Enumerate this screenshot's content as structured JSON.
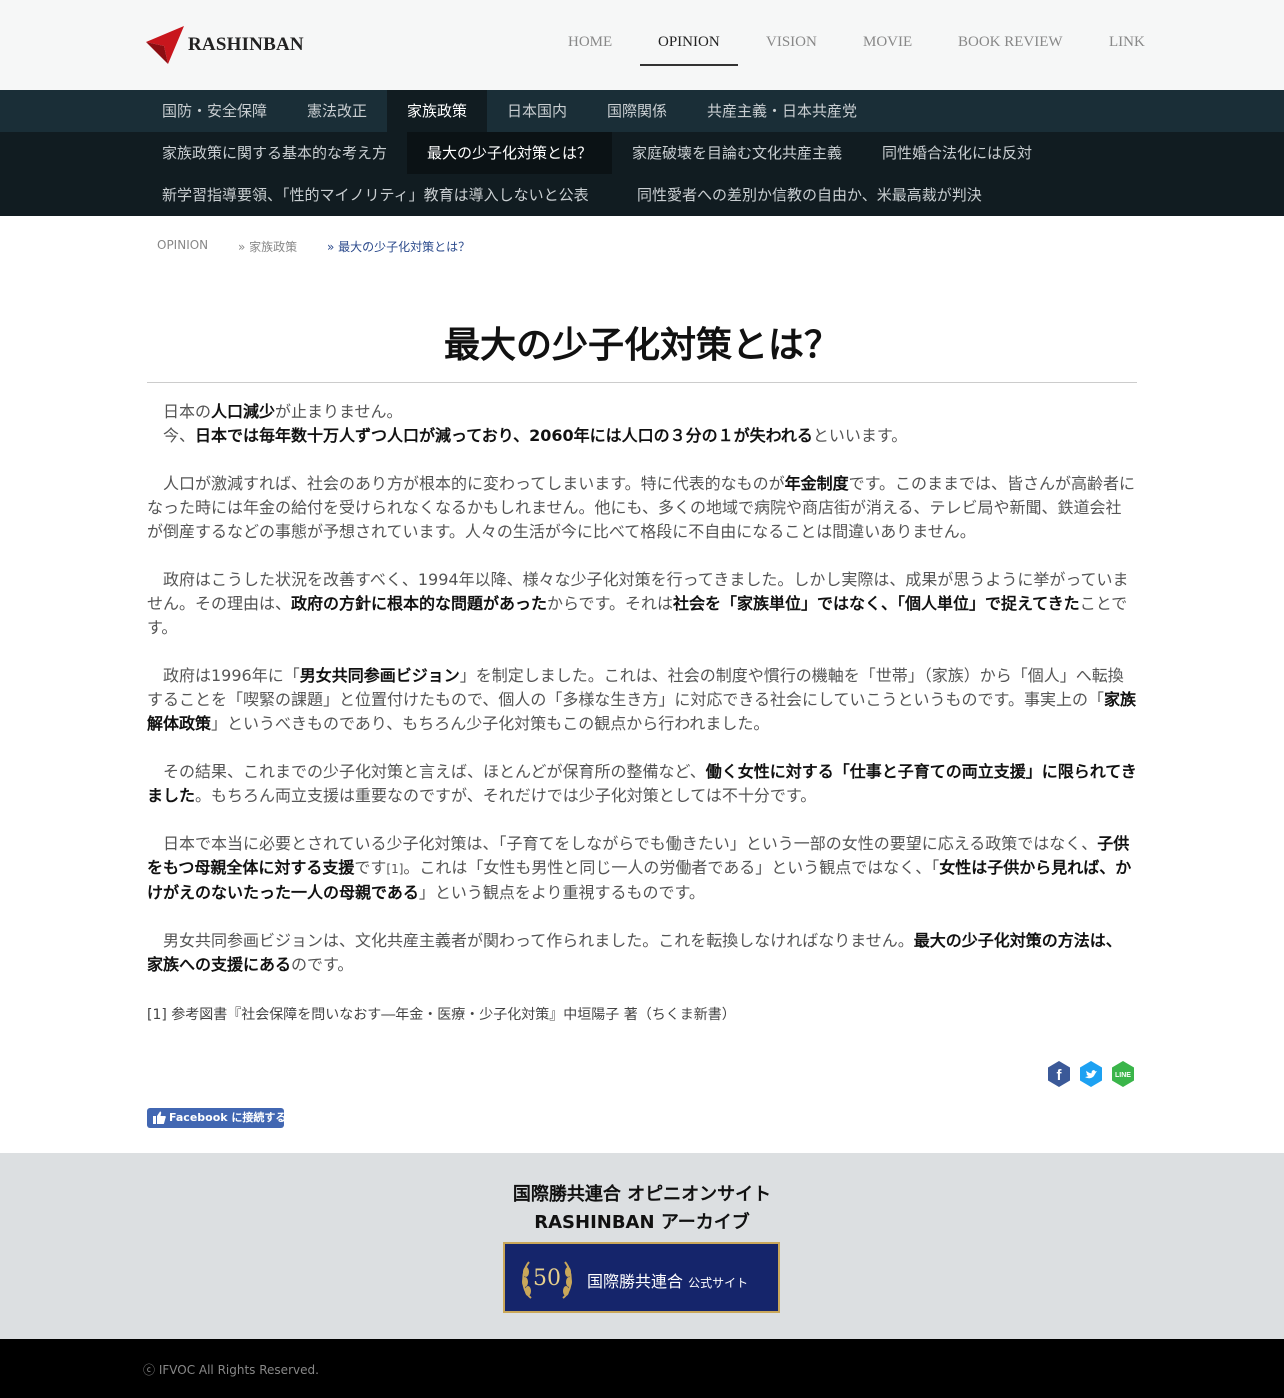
{
  "header": {
    "logo_text": "RASHINBAN",
    "nav": [
      {
        "label": "HOME",
        "active": false
      },
      {
        "label": "OPINION",
        "active": true
      },
      {
        "label": "VISION",
        "active": false
      },
      {
        "label": "MOVIE",
        "active": false
      },
      {
        "label": "BOOK REVIEW",
        "active": false
      },
      {
        "label": "LINK",
        "active": false
      }
    ]
  },
  "categories": [
    {
      "label": "国防・安全保障",
      "active": false
    },
    {
      "label": "憲法改正",
      "active": false
    },
    {
      "label": "家族政策",
      "active": true
    },
    {
      "label": "日本国内",
      "active": false
    },
    {
      "label": "国際関係",
      "active": false
    },
    {
      "label": "共産主義・日本共産党",
      "active": false
    }
  ],
  "subcategories": [
    {
      "label": "家族政策に関する基本的な考え方",
      "active": false
    },
    {
      "label": "最大の少子化対策とは？",
      "active": true
    },
    {
      "label": "家庭破壊を目論む文化共産主義",
      "active": false
    },
    {
      "label": "同性婚合法化には反対",
      "active": false
    },
    {
      "label": "新学習指導要領、「性的マイノリティ」教育は導入しないと公表",
      "active": false
    },
    {
      "label": "同性愛者への差別か信教の自由か、米最高裁が判決",
      "active": false
    }
  ],
  "breadcrumb": {
    "root": "OPINION",
    "parent": "» 家族政策",
    "current": "» 最大の少子化対策とは？"
  },
  "article": {
    "title": "最大の少子化対策とは？",
    "p1a": "日本の",
    "p1b": "人口減少",
    "p1c": "が止まりません。",
    "p2a": "今、",
    "p2b": "日本では毎年数十万人ずつ人口が減っており、2060年には人口の３分の１が失われる",
    "p2c": "といいます。",
    "p3a": "人口が激減すれば、社会のあり方が根本的に変わってしまいます。特に代表的なものが",
    "p3b": "年金制度",
    "p3c": "です。このままでは、皆さんが高齢者になった時には年金の給付を受けられなくなるかもしれません。他にも、多くの地域で病院や商店街が消える、テレビ局や新聞、鉄道会社が倒産するなどの事態が予想されています。人々の生活が今に比べて格段に不自由になることは間違いありません。",
    "p4a": "政府はこうした状況を改善すべく、1994年以降、様々な少子化対策を行ってきました。しかし実際は、成果が思うように挙がっていません。その理由は、",
    "p4b": "政府の方針に根本的な問題があった",
    "p4c": "からです。それは",
    "p4d": "社会を「家族単位」ではなく、「個人単位」で捉えてきた",
    "p4e": "ことです。",
    "p5a": "政府は1996年に「",
    "p5b": "男女共同参画ビジョン",
    "p5c": "」を制定しました。これは、社会の制度や慣行の機軸を「世帯」（家族）から「個人」へ転換することを「喫緊の課題」と位置付けたもので、個人の「多様な生き方」に対応できる社会にしていこうというものです。事実上の「",
    "p5d": "家族解体政策",
    "p5e": "」というべきものであり、もちろん少子化対策もこの観点から行われました。",
    "p6a": "その結果、これまでの少子化対策と言えば、ほとんどが保育所の整備など、",
    "p6b": "働く女性に対する「仕事と子育ての両立支援」に限られてきました",
    "p6c": "。もちろん両立支援は重要なのですが、それだけでは少子化対策としては不十分です。",
    "p7a": "日本で本当に必要とされている少子化対策は、「子育てをしながらでも働きたい」という一部の女性の要望に応える政策ではなく、",
    "p7b": "子供をもつ母親全体に対する支援",
    "p7c": "です",
    "p7ref": "[1]",
    "p7d": "。これは「女性も男性と同じ一人の労働者である」という観点ではなく、「",
    "p7e": "女性は子供から見れば、かけがえのないたった一人の母親である",
    "p7f": "」という観点をより重視するものです。",
    "p8a": "男女共同参画ビジョンは、文化共産主義者が関わって作られました。これを転換しなければなりません。",
    "p8b": "最大の少子化対策の方法は、家族への支援にある",
    "p8c": "のです。",
    "footnote": "[1] 参考図書『社会保障を問いなおす―年金・医療・少子化対策』中垣陽子 著（ちくま新書）"
  },
  "share": {
    "facebook_color": "#3b5998",
    "twitter_color": "#1da1f2",
    "line_color": "#3ab54a",
    "line_label": "LINE"
  },
  "fb_connect_label": "Facebook に接続する",
  "footer": {
    "line1": "国際勝共連合 オピニオンサイト",
    "line2": "RASHINBAN アーカイブ",
    "banner_badge": "50",
    "banner_text": "国際勝共連合",
    "banner_suffix": "公式サイト",
    "copyright": "ⓒ IFVOC All Rights Reserved."
  }
}
